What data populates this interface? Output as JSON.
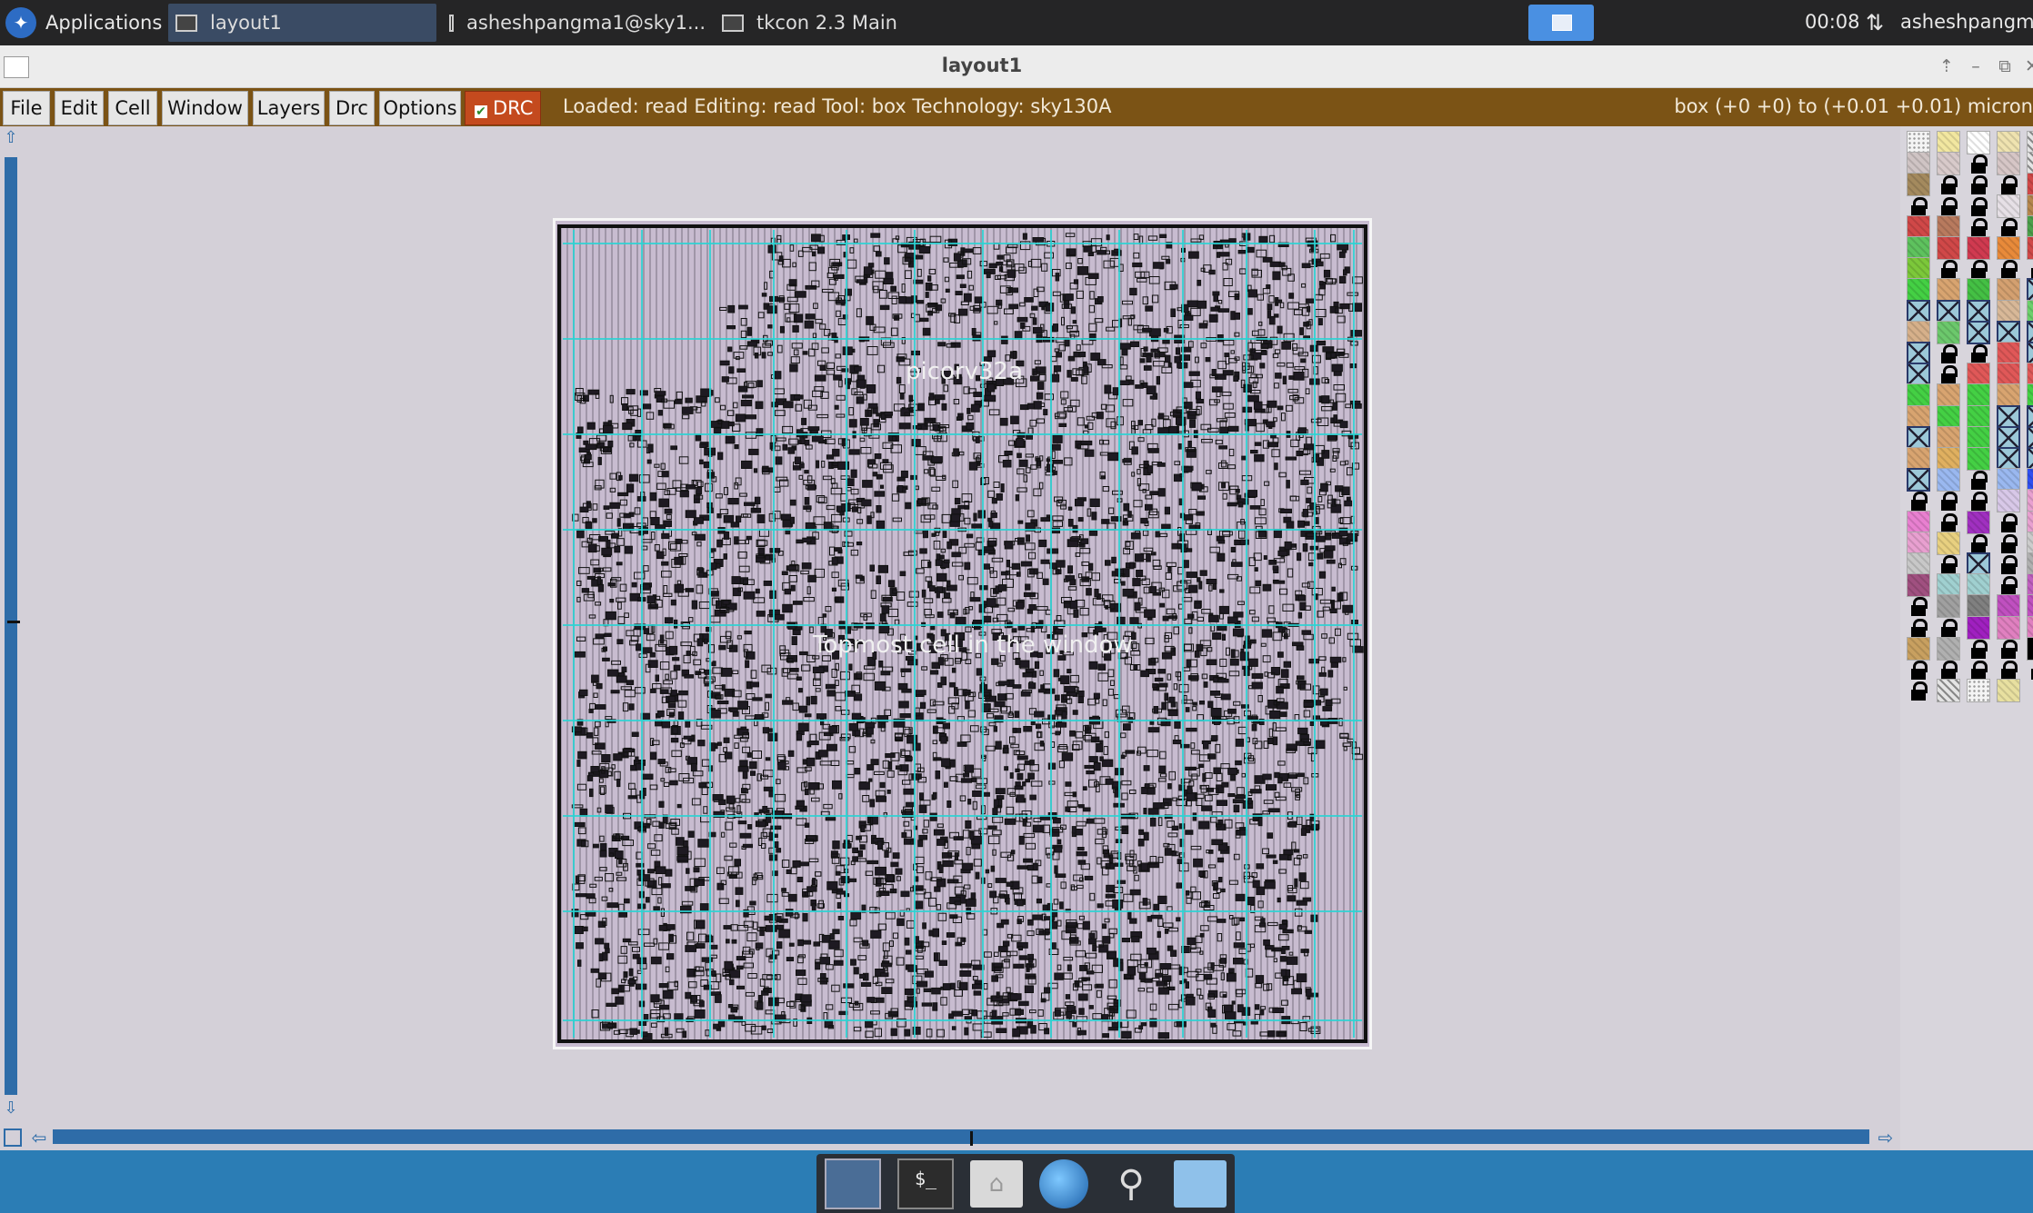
{
  "taskbar": {
    "apps_label": "Applications",
    "tasks": [
      {
        "label": "layout1"
      },
      {
        "label": "asheshpangma1@sky1..."
      },
      {
        "label": "tkcon 2.3 Main"
      }
    ],
    "clock": "00:08",
    "user": "asheshpangma"
  },
  "window": {
    "title": "layout1"
  },
  "menubar": {
    "items": [
      "File",
      "Edit",
      "Cell",
      "Window",
      "Layers",
      "Drc",
      "Options"
    ],
    "drc_label": "DRC",
    "drc_checked": true,
    "status": "Loaded: read Editing: read Tool: box  Technology: sky130A",
    "box_info": "box (+0 +0) to (+0.01 +0.01) micron"
  },
  "canvas": {
    "cell_name": "picorv32a",
    "cell_note": "Topmost cell in the window",
    "layout_bg": "#c8bcd0",
    "grid_color": "#2ad4d4"
  },
  "palette": {
    "rows": [
      [
        "dots",
        "#f2e7a0",
        "#ffffff",
        "#efe3b0",
        "hatch-grey"
      ],
      [
        "#cfc4c4",
        "#d8caca",
        "lock",
        "#d6c6c6",
        "hatch-grey"
      ],
      [
        "#a48a5e",
        "lock",
        "lock",
        "lock",
        "#d04848"
      ],
      [
        "lock",
        "lock",
        "lock",
        "#e6e0e6",
        "#b6874e"
      ],
      [
        "#d04848",
        "#b87a5e",
        "lock",
        "lock",
        "#4ca04c"
      ],
      [
        "#5ec25e",
        "#d04848",
        "#d03a50",
        "#e88a3a",
        "#d04848"
      ],
      [
        "#7cc83a",
        "lock",
        "lock",
        "lock",
        "lock"
      ],
      [
        "#44d044",
        "#d8a470",
        "#44c044",
        "#d4a070",
        "xbox"
      ],
      [
        "xbox",
        "xbox",
        "xbox",
        "#d8b898",
        "#6cd06c"
      ],
      [
        "#d6b08a",
        "#6cc86c",
        "xbox",
        "xbox",
        "xbox"
      ],
      [
        "xbox",
        "lock",
        "lock",
        "#e05858",
        "xbox"
      ],
      [
        "xbox",
        "lock",
        "#e05858",
        "#e05858",
        "#e05858"
      ],
      [
        "#44d044",
        "#d8a470",
        "#44d044",
        "#d8a470",
        "#44d044"
      ],
      [
        "#d8a470",
        "#44d044",
        "#44d044",
        "xbox",
        "xbox"
      ],
      [
        "xbox",
        "#d8a470",
        "#44d044",
        "xbox",
        "xbox"
      ],
      [
        "#d8a470",
        "#e0b060",
        "#44d044",
        "xbox",
        "xbox"
      ],
      [
        "xbox",
        "#9ab8f0",
        "lock",
        "#9ab8f0",
        "#3050f0"
      ],
      [
        "lock",
        "lock",
        "lock",
        "#d8c8e8",
        "#e8a0d0"
      ],
      [
        "#e880d0",
        "lock",
        "#a030c0",
        "lock",
        "#e8a0d0"
      ],
      [
        "#e8a0d0",
        "#e8d080",
        "lock",
        "lock",
        "#cccccc"
      ],
      [
        "#c8c8c8",
        "lock",
        "xbox",
        "lock",
        "#b0b0b0"
      ],
      [
        "#a05080",
        "#a0d0d0",
        "#a0d0d0",
        "lock",
        "#c060c0"
      ],
      [
        "lock",
        "#a0a0a0",
        "#808080",
        "#c050c0",
        "#c050c0"
      ],
      [
        "lock",
        "lock",
        "#a020c0",
        "#e080c0",
        "#e080c0"
      ],
      [
        "#c8a060",
        "#b0b0b0",
        "lock",
        "lock",
        "#000000"
      ],
      [
        "lock",
        "lock",
        "lock",
        "lock",
        "lock"
      ],
      [
        "lock",
        "hatch-grey",
        "dots",
        "#e8e0a0",
        ""
      ]
    ]
  }
}
